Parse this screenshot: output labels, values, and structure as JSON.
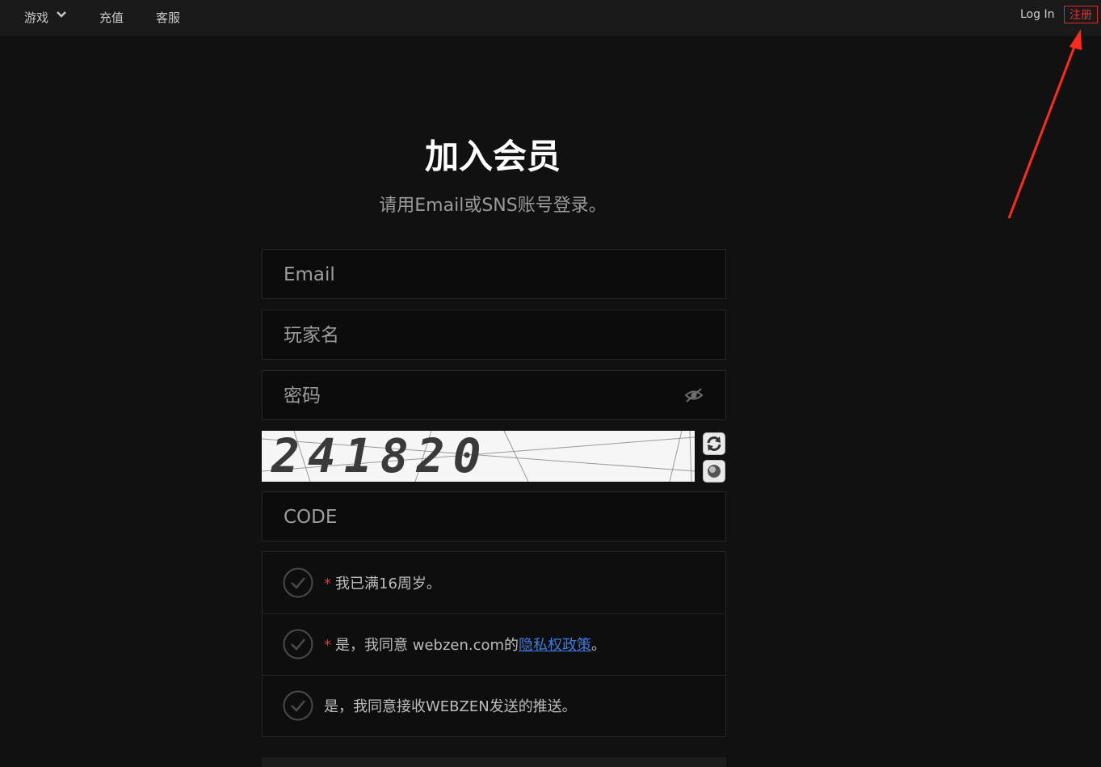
{
  "nav": {
    "games_label": "游戏",
    "recharge_label": "充值",
    "support_label": "客服",
    "login_label": "Log In",
    "register_label": "注册"
  },
  "form": {
    "title": "加入会员",
    "subtitle": "请用Email或SNS账号登录。",
    "email_placeholder": "Email",
    "player_name_placeholder": "玩家名",
    "password_placeholder": "密码",
    "captcha_text": "241820",
    "code_placeholder": "CODE"
  },
  "agreements": {
    "age": {
      "required_mark": "*",
      "label": "我已满16周岁。"
    },
    "privacy": {
      "required_mark": "*",
      "label_before": "是，我同意 webzen.com的",
      "link_text": "隐私权政策",
      "label_after": "。"
    },
    "push": {
      "label": "是，我同意接收WEBZEN发送的推送。"
    }
  },
  "colors": {
    "accent_red": "#e83030",
    "link_blue": "#3c7be0",
    "background": "#111111"
  }
}
